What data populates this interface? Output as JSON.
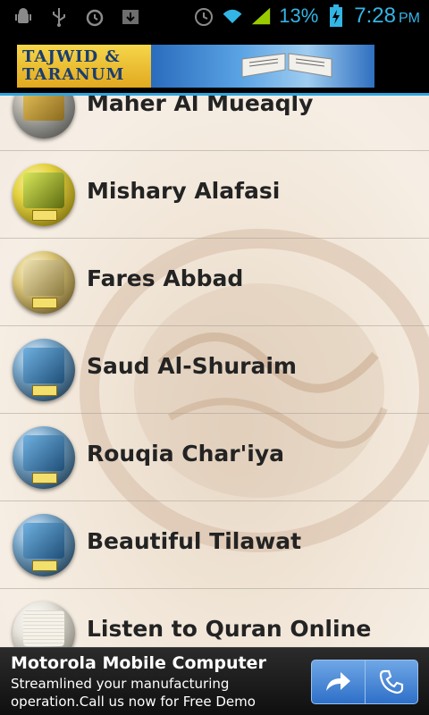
{
  "status_bar": {
    "battery": "13%",
    "time": "7:28",
    "ampm": "PM",
    "accent_color": "#33b5e5"
  },
  "header": {
    "logo_line1": "TAJWID &",
    "logo_line2": "TARANUM"
  },
  "list": {
    "items": [
      {
        "label": "Maher Al Mueaqly",
        "icon": "reciter-thumbnail-gold"
      },
      {
        "label": "Mishary Alafasi",
        "icon": "reciter-thumbnail-gold"
      },
      {
        "label": "Fares Abbad",
        "icon": "reciter-thumbnail-book"
      },
      {
        "label": "Saud Al-Shuraim",
        "icon": "reciter-thumbnail-blue"
      },
      {
        "label": "Rouqia Char'iya",
        "icon": "reciter-thumbnail-blue"
      },
      {
        "label": "Beautiful Tilawat",
        "icon": "reciter-thumbnail-blue"
      },
      {
        "label": "Listen to Quran Online",
        "icon": "quran-book-thumbnail"
      }
    ]
  },
  "ad": {
    "title": "Motorola Mobile Computer",
    "body": "Streamlined your manufacturing operation.Call us now for Free Demo",
    "share_icon": "share-arrow-icon",
    "call_icon": "phone-icon",
    "button_color": "#3a7ad0"
  }
}
